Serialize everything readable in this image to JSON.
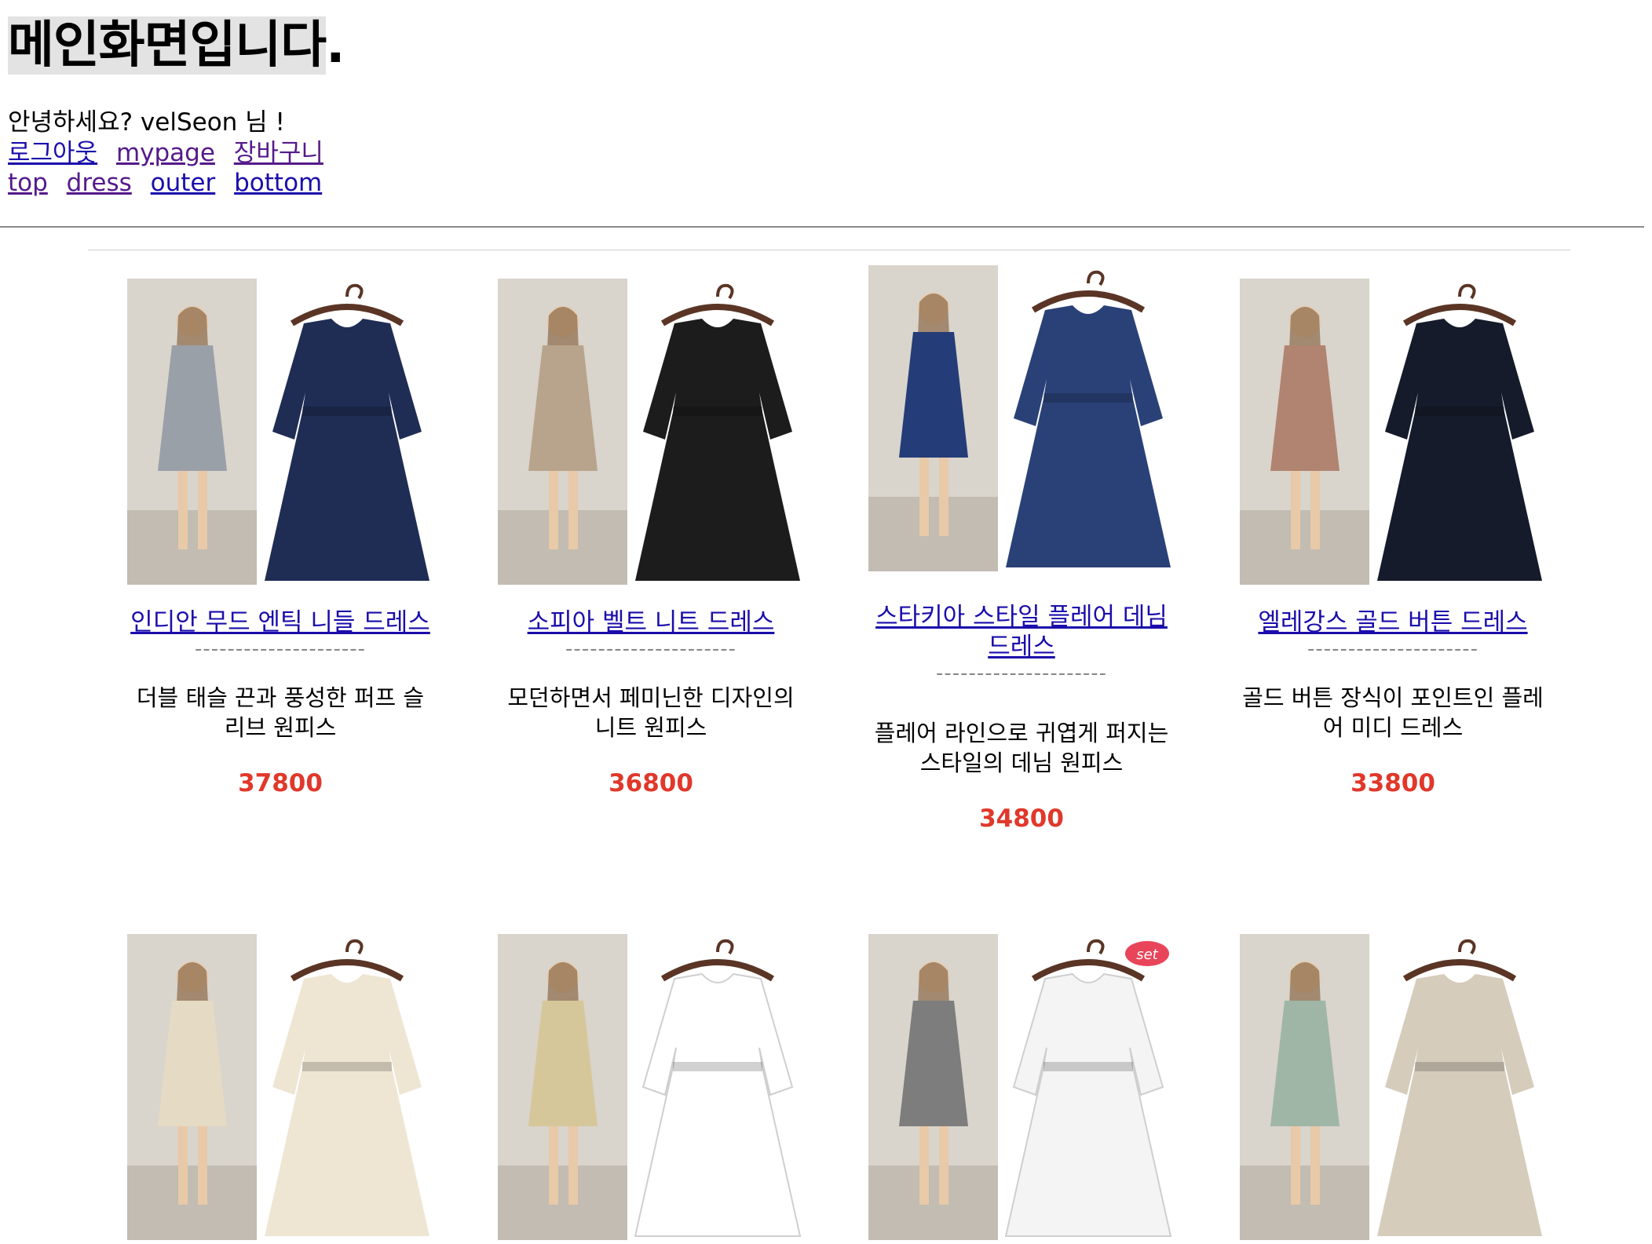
{
  "page": {
    "title_main": "메인화면입니다",
    "title_dot": ".",
    "greeting": "안녕하세요? velSeon 님 !"
  },
  "nav": {
    "user_links": [
      "로그아웃",
      "mypage",
      "장바구니"
    ],
    "category_links": [
      "top",
      "dress",
      "outer",
      "bottom"
    ]
  },
  "products": [
    {
      "name": "인디안 무드 엔틱 니들 드레스",
      "dashes": "---------------------",
      "desc": "더블 태슬 끈과 풍성한 퍼프 슬리브 원피스",
      "price": "37800",
      "colors": {
        "model": "#9aa0a8",
        "dress": "#1f2d55"
      }
    },
    {
      "name": "소피아 벨트 니트 드레스",
      "dashes": "---------------------",
      "desc": "모던하면서 페미닌한 디자인의 니트 원피스",
      "price": "36800",
      "colors": {
        "model": "#b8a48c",
        "dress": "#1c1c1c"
      }
    },
    {
      "name": "스타키아 스타일 플레어 데님 드레스",
      "dashes": "---------------------",
      "desc": "플레어 라인으로 귀엽게 퍼지는 스타일의 데님 원피스",
      "price": "34800",
      "colors": {
        "model": "#243c78",
        "dress": "#2a4177"
      }
    },
    {
      "name": "엘레강스 골드 버튼 드레스",
      "dashes": "---------------------",
      "desc": "골드 버튼 장식이 포인트인 플레어 미디 드레스",
      "price": "33800",
      "colors": {
        "model": "#b08470",
        "dress": "#151b2a"
      }
    }
  ],
  "products_row2": [
    {
      "colors": {
        "model": "#e5dac4",
        "dress": "#eee6d3"
      }
    },
    {
      "colors": {
        "model": "#d6c79a",
        "dress": "#ffffff"
      }
    },
    {
      "colors": {
        "model": "#7d7d7d",
        "dress": "#f4f4f4"
      },
      "badge": "set"
    },
    {
      "colors": {
        "model": "#9fb6a6",
        "dress": "#d6ccbb"
      }
    }
  ],
  "colors": {
    "link": "#1a0dab",
    "link_visited": "#551a8b",
    "price": "#e0382b",
    "hanger": "#5a3525"
  }
}
